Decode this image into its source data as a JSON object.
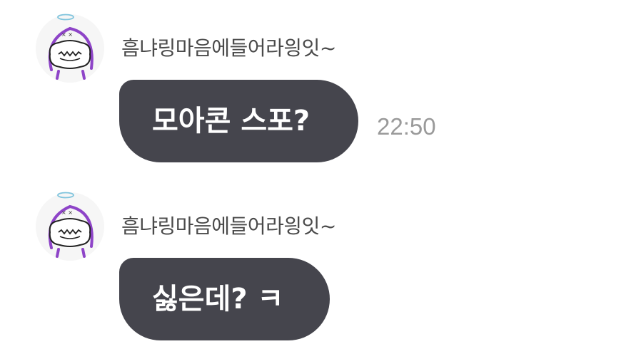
{
  "chat": {
    "messages": [
      {
        "sender": "흠냐링마음에들어라읭잇~",
        "text": "모아콘 스포?",
        "time": "22:50"
      },
      {
        "sender": "흠냐링마음에들어라읭잇~",
        "text": "싫은데? ㅋ"
      }
    ]
  },
  "colors": {
    "bubble": "#45454d",
    "bubble_text": "#ffffff",
    "sender_text": "#4a4a4a",
    "timestamp": "#9a9a9a",
    "avatar_accent": "#8e44c8"
  },
  "icons": {
    "avatar": "character-with-halo-avatar-icon"
  }
}
